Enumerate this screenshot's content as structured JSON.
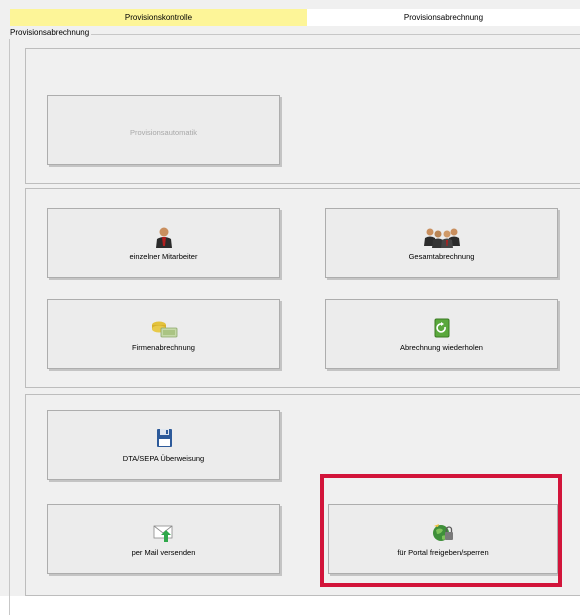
{
  "tabs": [
    {
      "label": "Provisionskontrolle"
    },
    {
      "label": "Provisionsabrechnung"
    }
  ],
  "group": {
    "legend": "Provisionsabrechnung"
  },
  "buttons": {
    "provisionsautomatik": {
      "label": "Provisionsautomatik",
      "enabled": false
    },
    "einzelner_mitarbeiter": {
      "label": "einzelner Mitarbeiter",
      "icon": "person-icon"
    },
    "gesamtabrechnung": {
      "label": "Gesamtabrechnung",
      "icon": "group-icon"
    },
    "firmenabrechnung": {
      "label": "Firmenabrechnung",
      "icon": "money-icon"
    },
    "abrechnung_wiederholen": {
      "label": "Abrechnung wiederholen",
      "icon": "repeat-icon"
    },
    "dta_sepa": {
      "label": "DTA/SEPA Überweisung",
      "icon": "floppy-disk-icon"
    },
    "per_mail": {
      "label": "per Mail versenden",
      "icon": "mail-send-icon"
    },
    "portal": {
      "label": "für Portal freigeben/sperren",
      "icon": "portal-lock-icon"
    }
  },
  "colors": {
    "active_tab": "#fdf598",
    "highlight": "#d2143a",
    "panel": "#f0f0f0"
  }
}
